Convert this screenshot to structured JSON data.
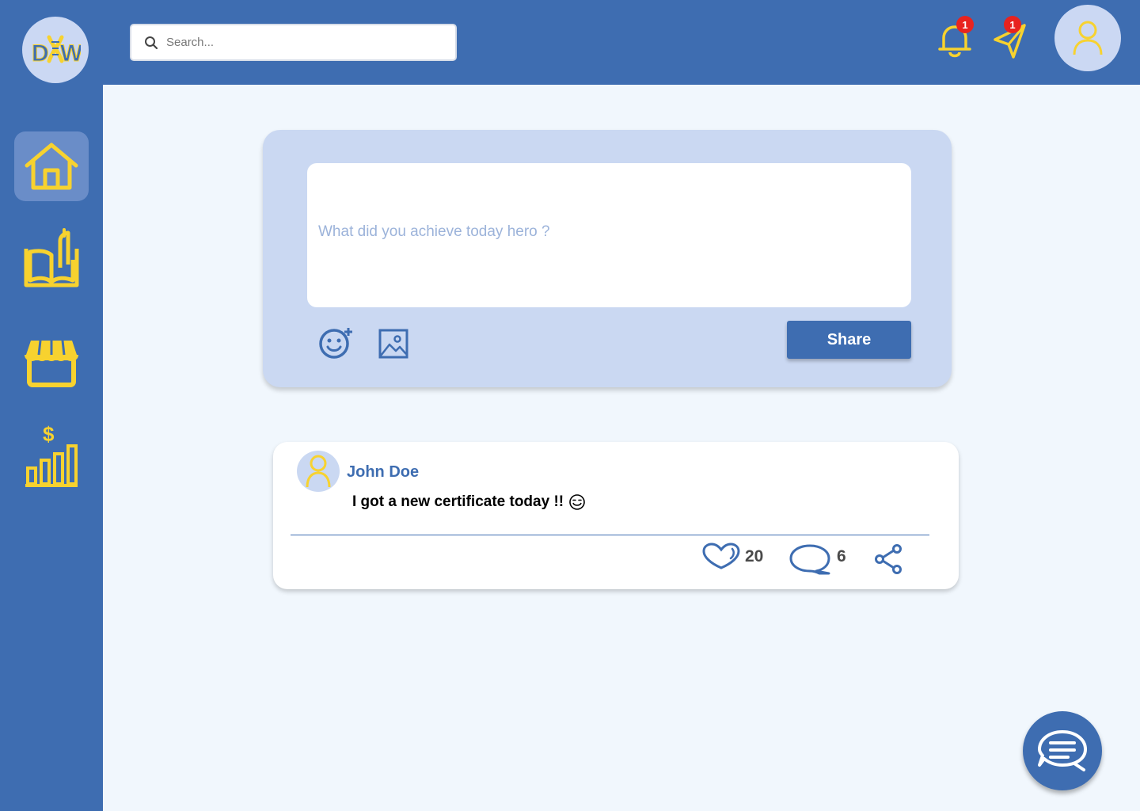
{
  "brand": {
    "logo_text": "DXW",
    "logo_colors": {
      "primary": "#3e6db1",
      "accent": "#f7d22f"
    }
  },
  "colors": {
    "primary": "#3e6db1",
    "accent_yellow": "#f7d22f",
    "light_blue": "#cad8f2",
    "background": "#f1f7fd",
    "badge_red": "#e8231f"
  },
  "sidebar": {
    "items": [
      {
        "icon": "home-icon",
        "active": true
      },
      {
        "icon": "book-icon",
        "active": false
      },
      {
        "icon": "store-icon",
        "active": false
      },
      {
        "icon": "finance-chart-icon",
        "active": false
      }
    ]
  },
  "header": {
    "search": {
      "placeholder": "Search...",
      "value": ""
    },
    "notifications": {
      "icon": "bell-icon",
      "count": "1"
    },
    "messages": {
      "icon": "send-icon",
      "count": "1"
    },
    "profile": {
      "icon": "user-icon"
    }
  },
  "composer": {
    "placeholder": "What did you achieve today hero ?",
    "value": "",
    "emoji_tool": "emoji-add-icon",
    "image_tool": "image-icon",
    "share_label": "Share"
  },
  "post": {
    "author": "John Doe",
    "content": "I got a new certificate today !!",
    "emoji": "smile-icon",
    "likes": "20",
    "comments": "6"
  },
  "chat": {
    "icon": "chat-icon"
  }
}
